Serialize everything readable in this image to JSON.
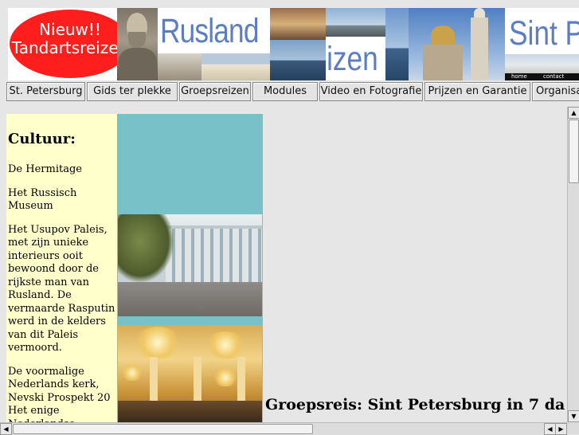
{
  "banner": {
    "oval_line1": "Nieuw!!",
    "oval_line2": "Tandartsreizen",
    "title_rusland": "Rusland",
    "title_reizen": "Reizen",
    "title_sint_petersburg": "Sint Pe",
    "link_home": "home",
    "link_contact": "contact",
    "oval_color": "#ff1e1e",
    "title_color": "#5c7ec0"
  },
  "nav": {
    "items": [
      {
        "label": "St. Petersburg"
      },
      {
        "label": "Gids ter plekke"
      },
      {
        "label": "Groepsreizen"
      },
      {
        "label": "Modules"
      },
      {
        "label": "Video en Fotografie"
      },
      {
        "label": "Prijzen en Garantie"
      },
      {
        "label": "Organisa"
      }
    ]
  },
  "sidebar": {
    "heading": "Cultuur:",
    "paragraphs": [
      "De Hermitage",
      "Het Russisch Museum",
      "Het Usupov Paleis, met zijn unieke interieurs ooit bewoond door de rijkste man van Rusland. De vermaarde Rasputin werd in de kelders van dit Paleis vermoord.",
      "De voormalige Nederlands kerk, Nevski Prospekt 20 Het enige Nederlandse gebouw"
    ],
    "background": "#ffffcc"
  },
  "photos": {
    "teal_color": "#78c1c9"
  },
  "main": {
    "heading": "Groepsreis: Sint Petersburg in 7 da"
  },
  "scrollbars": {
    "up_icon": "▲",
    "down_icon": "▼",
    "left_icon": "◀",
    "right_icon": "▶"
  }
}
